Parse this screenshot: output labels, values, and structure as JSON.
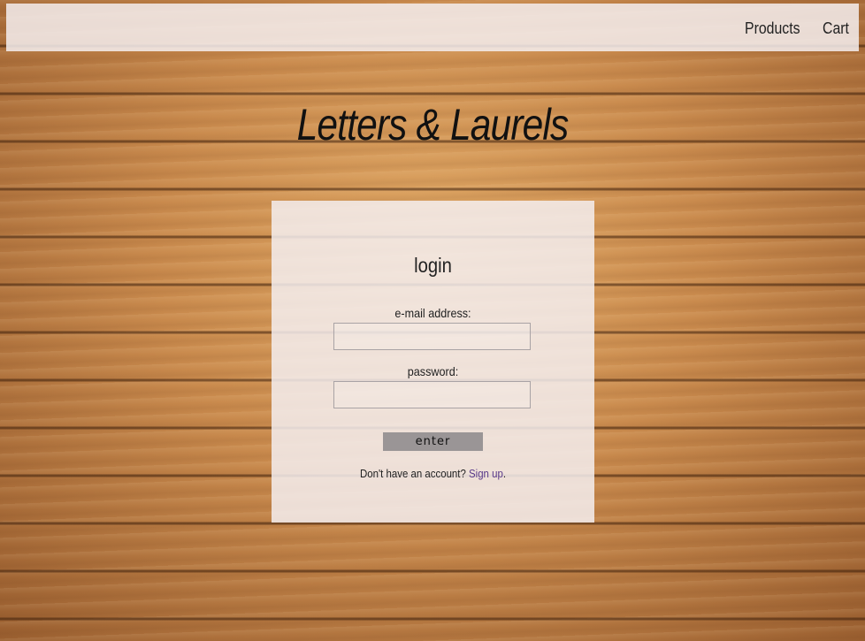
{
  "nav": {
    "products_label": "Products",
    "cart_label": "Cart"
  },
  "site": {
    "title": "Letters & Laurels"
  },
  "login": {
    "heading": "login",
    "email_label": "e-mail address:",
    "email_value": "",
    "password_label": "password:",
    "password_value": "",
    "enter_label": "enter",
    "signup_prompt": "Don't have an account?",
    "signup_link": "Sign up",
    "signup_suffix": "."
  },
  "colors": {
    "panel_background": "#f5eef0",
    "button_background": "#9a9596",
    "link_color": "#5a3a8a"
  }
}
